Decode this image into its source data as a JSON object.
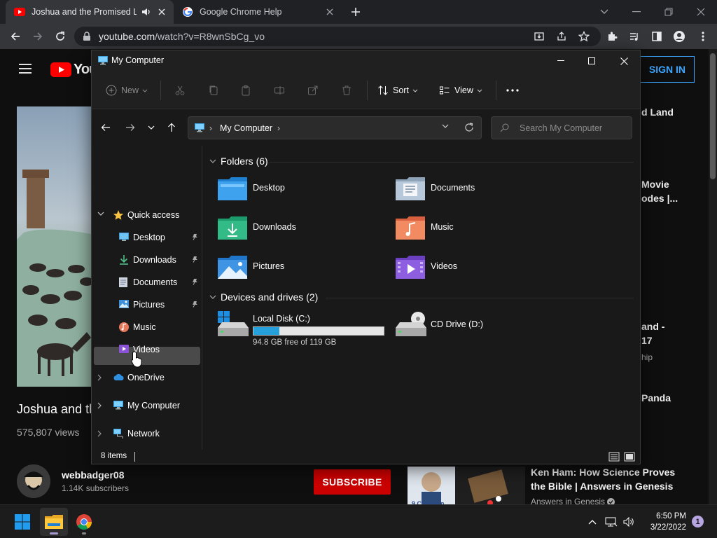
{
  "browser": {
    "tabs": [
      {
        "title": "Joshua and the Promised Land",
        "active": true
      },
      {
        "title": "Google Chrome Help",
        "active": false
      }
    ],
    "url": {
      "host": "youtube.com",
      "path": "/watch?v=R8wnSbCg_vo"
    }
  },
  "youtube": {
    "sign_in": "SIGN IN",
    "video_title": "Joshua and th",
    "views": "575,807 views",
    "channel": "webbadger08",
    "subscribers": "1.14K subscribers",
    "subscribe": "SUBSCRIBE",
    "sidebar_fragments": [
      "d Land",
      "Movie",
      "odes |...",
      "and -",
      "17",
      "hip",
      "Panda"
    ],
    "recommended": {
      "title": "Ken Ham: How Science Proves the Bible | Answers in Genesis",
      "channel": "Answers in Genesis",
      "thumb_caption": "9 Common"
    }
  },
  "explorer": {
    "title": "My Computer",
    "commands": {
      "new": "New",
      "sort": "Sort",
      "view": "View",
      "more": "..."
    },
    "address": "My Computer",
    "search_placeholder": "Search My Computer",
    "nav": {
      "quick_access": "Quick access",
      "quick_items": [
        "Desktop",
        "Downloads",
        "Documents",
        "Pictures",
        "Music",
        "Videos"
      ],
      "onedrive": "OneDrive",
      "my_computer": "My Computer",
      "network": "Network"
    },
    "folders_header": "Folders (6)",
    "folders": [
      "Desktop",
      "Documents",
      "Downloads",
      "Music",
      "Pictures",
      "Videos"
    ],
    "drives_header": "Devices and drives (2)",
    "drives": [
      {
        "name": "Local Disk (C:)",
        "free_text": "94.8 GB free of 119 GB",
        "used_fraction": 0.2
      },
      {
        "name": "CD Drive (D:)"
      }
    ],
    "status": "8 items"
  },
  "taskbar": {
    "time": "6:50 PM",
    "date": "3/22/2022",
    "notifications": "1"
  },
  "colors": {
    "accent": "#26a0da",
    "youtube_red": "#cc0000",
    "signin_blue": "#3ea6ff"
  }
}
